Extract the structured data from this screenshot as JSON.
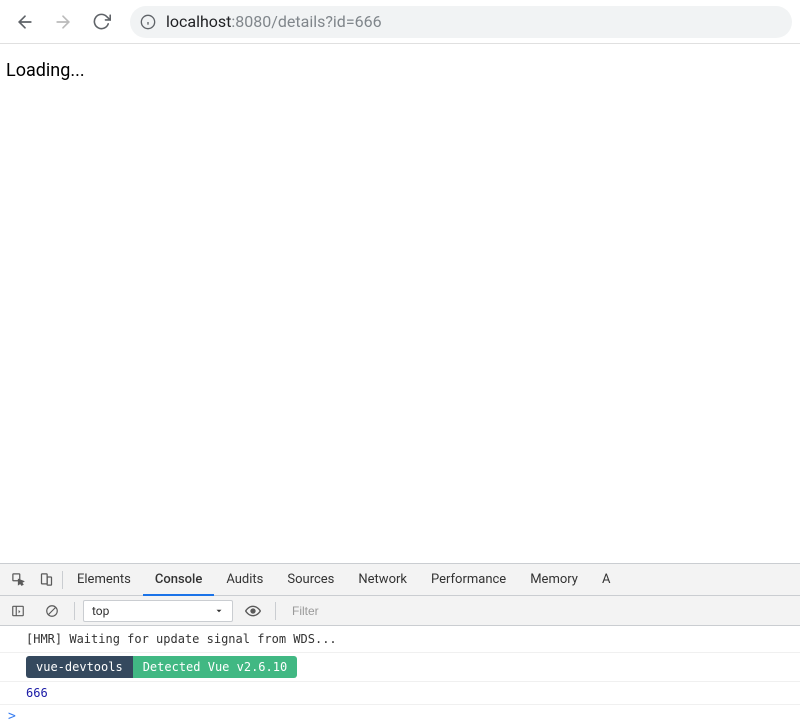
{
  "browser": {
    "url_host": "localhost",
    "url_rest": ":8080/details?id=666"
  },
  "page": {
    "loading_text": "Loading..."
  },
  "devtools": {
    "tabs": {
      "elements": "Elements",
      "console": "Console",
      "audits": "Audits",
      "sources": "Sources",
      "network": "Network",
      "performance": "Performance",
      "memory": "Memory",
      "application_partial": "A"
    },
    "filter_bar": {
      "context": "top",
      "filter_placeholder": "Filter"
    },
    "console": {
      "hmr_line": "[HMR] Waiting for update signal from WDS...",
      "vue_pill_left": "vue-devtools",
      "vue_pill_right": "Detected Vue v2.6.10",
      "value_line": "666",
      "prompt": ">"
    }
  }
}
